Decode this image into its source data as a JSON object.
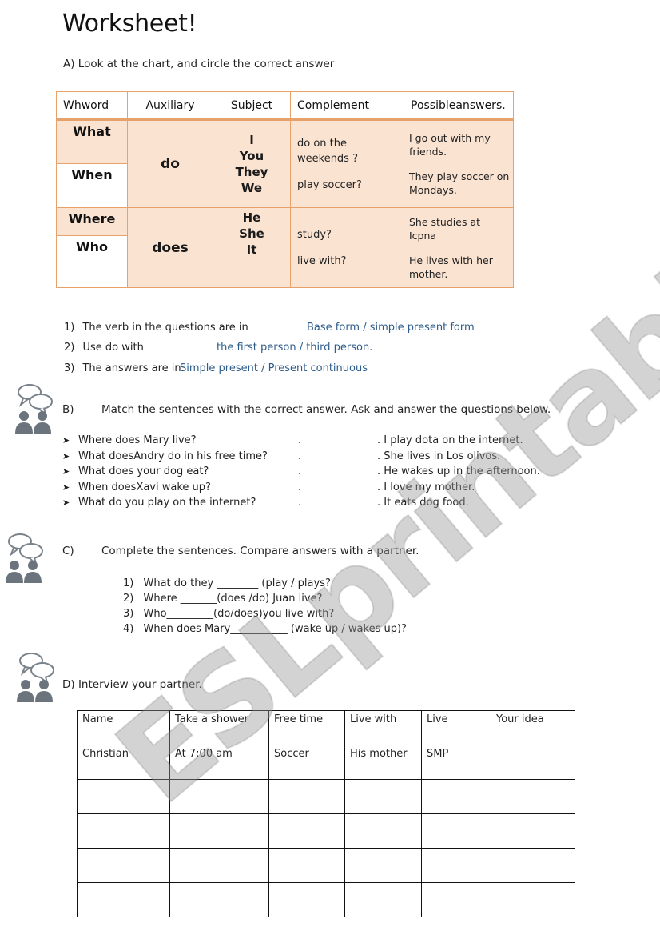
{
  "title": "Worksheet!",
  "section_a": {
    "instruction": "A)  Look at the chart, and circle the correct answer",
    "chart": {
      "headers": [
        "Whword",
        "Auxiliary",
        "Subject",
        "Complement",
        "Possibleanswers."
      ],
      "wh_words": [
        "What",
        "When",
        "Where",
        "Who"
      ],
      "groups": [
        {
          "auxiliary": "do",
          "subjects": [
            "I",
            "You",
            "They",
            "We"
          ],
          "complements": [
            "do on the weekends ?",
            "play soccer?"
          ],
          "answers": [
            "I go out with my friends.",
            "They play soccer on Mondays."
          ]
        },
        {
          "auxiliary": "does",
          "subjects": [
            "He",
            "She",
            "It"
          ],
          "complements": [
            "study?",
            "live with?"
          ],
          "answers": [
            "She studies at Icpna",
            "He lives with her mother."
          ]
        }
      ]
    },
    "questions": [
      {
        "num": "1)",
        "text": "The verb in the questions are in",
        "options": "Base form / simple present form"
      },
      {
        "num": "2)",
        "text": "Use do with",
        "options": "the first person / third person."
      },
      {
        "num": "3)",
        "text": "The answers are in",
        "options": "Simple present  / Present continuous"
      }
    ]
  },
  "section_b": {
    "label": "B)",
    "instruction": "Match the sentences with the correct answer. Ask and answer the questions below.",
    "questions": [
      "Where does Mary live?",
      "What doesAndry do in his free time?",
      "What does your dog eat?",
      "When doesXavi wake up?",
      "What do you play on the internet?"
    ],
    "answers": [
      ". I play dota on the internet.",
      ". She lives in Los olivos.",
      ". He wakes up in the afternoon.",
      ". I love my mother.",
      ". It eats dog food."
    ],
    "dot": "."
  },
  "section_c": {
    "label": "C)",
    "instruction": "Complete the sentences. Compare answers with a partner.",
    "items": [
      {
        "num": "1)",
        "text": "What do they ________ (play / plays?"
      },
      {
        "num": "2)",
        "text": "Where _______(does /do) Juan live?"
      },
      {
        "num": "3)",
        "text": "Who_________(do/does)you live with?"
      },
      {
        "num": "4)",
        "text": "When does Mary___________ (wake up / wakes up)?"
      }
    ]
  },
  "section_d": {
    "instruction": "D)  Interview your partner.",
    "table": {
      "headers": [
        "Name",
        "Take a shower",
        "Free time",
        "Live with",
        "Live",
        "Your idea"
      ],
      "rows": [
        [
          "Christian",
          "At 7:00 am",
          "Soccer",
          "His mother",
          "SMP",
          ""
        ],
        [
          "",
          "",
          "",
          "",
          "",
          ""
        ],
        [
          "",
          "",
          "",
          "",
          "",
          ""
        ],
        [
          "",
          "",
          "",
          "",
          "",
          ""
        ],
        [
          "",
          "",
          "",
          "",
          "",
          ""
        ]
      ]
    }
  },
  "watermark": "ESLprintables.com",
  "colors": {
    "table_border": "#e6a26a",
    "table_fill": "#fbe3d1",
    "option_text": "#2e5c8a",
    "icon_gray": "#6b747c"
  }
}
